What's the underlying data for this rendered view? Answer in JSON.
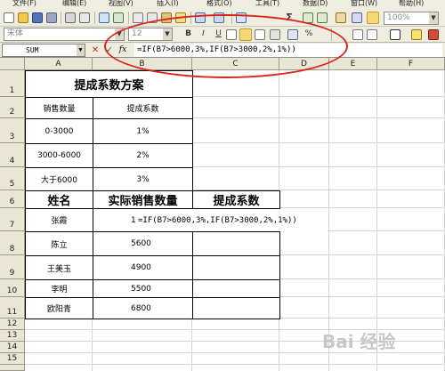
{
  "menus": [
    "文件(F)",
    "编辑(E)",
    "视图(V)",
    "插入(I)",
    "格式(O)",
    "工具(T)",
    "数据(D)",
    "窗口(W)",
    "帮助(H)"
  ],
  "toolbar": {
    "font_name": "宋体",
    "font_size": "12",
    "zoom": "100%",
    "sigma": "Σ",
    "bold": "B",
    "italic": "I",
    "underline": "U",
    "percent": "%"
  },
  "formula_bar": {
    "name_box": "SUM",
    "cancel": "✕",
    "enter": "✓",
    "fx": "fx",
    "formula": "=IF(B7>6000,3%,IF(B7>3000,2%,1%))"
  },
  "columns": [
    "A",
    "B",
    "C",
    "D",
    "E",
    "F"
  ],
  "rows": [
    "1",
    "2",
    "3",
    "4",
    "5",
    "6",
    "7",
    "8",
    "9",
    "10",
    "11",
    "12",
    "13",
    "14",
    "15"
  ],
  "table1": {
    "title": "提成系数方案",
    "headers": [
      "销售数量",
      "提成系数"
    ],
    "rows": [
      [
        "0-3000",
        "1%"
      ],
      [
        "3000-6000",
        "2%"
      ],
      [
        "大于6000",
        "3%"
      ]
    ]
  },
  "table2": {
    "headers": [
      "姓名",
      "实际销售数量",
      "提成系数"
    ],
    "rows": [
      {
        "name": "张霞",
        "qty": "18",
        "formula": "=IF(B7>6000,3%,IF(B7>3000,2%,1%))"
      },
      {
        "name": "陈立",
        "qty": "5600",
        "formula": ""
      },
      {
        "name": "王美玉",
        "qty": "4900",
        "formula": ""
      },
      {
        "name": "李明",
        "qty": "5500",
        "formula": ""
      },
      {
        "name": "欧阳青",
        "qty": "6800",
        "formula": ""
      }
    ]
  },
  "watermark": "Bai 经验"
}
